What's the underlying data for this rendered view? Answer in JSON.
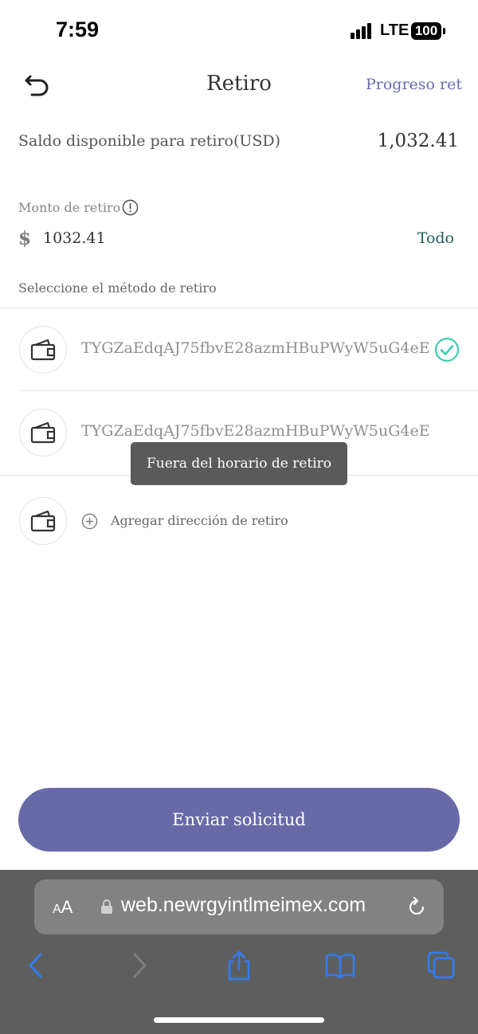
{
  "status_bar": {
    "time": "7:59",
    "network": "LTE",
    "battery": "100"
  },
  "header": {
    "title": "Retiro",
    "progress_link": "Progreso ret",
    "back_icon": "undo-arrow-icon"
  },
  "balance": {
    "label": "Saldo disponible para retiro(USD)",
    "value": "1,032.41"
  },
  "amount": {
    "label": "Monto de retiro",
    "currency_symbol": "$",
    "value": "1032.41",
    "all_label": "Todo",
    "info_icon": "info-circle-icon"
  },
  "method": {
    "label": "Seleccione el método de retiro",
    "addresses": [
      {
        "address": "TYGZaEdqAJ75fbvE28azmHBuPWyW5uG4eE",
        "selected": true
      },
      {
        "address": "TYGZaEdqAJ75fbvE28azmHBuPWyW5uG4eE",
        "selected": false
      }
    ],
    "add_label": "Agregar dirección de retiro"
  },
  "toast": {
    "message": "Fuera del horario de retiro"
  },
  "submit": {
    "label": "Enviar solicitud"
  },
  "browser": {
    "aa_label_small": "A",
    "aa_label_large": "A",
    "url": "web.newrgyintlmeimex.com"
  },
  "colors": {
    "accent": "#6a69a8",
    "success": "#3ccfb0",
    "all_link": "#1f5e56",
    "ios_blue": "#2f7cf6"
  }
}
